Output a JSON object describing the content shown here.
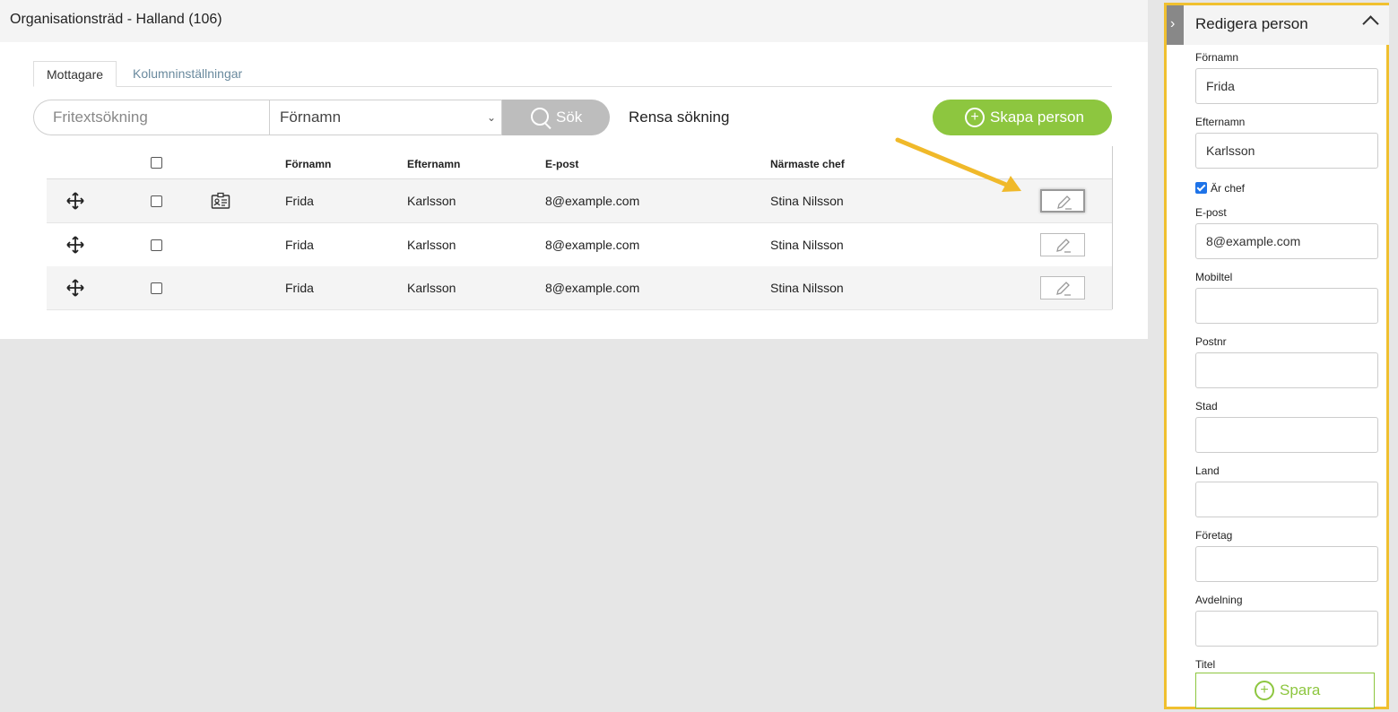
{
  "header": {
    "title": "Organisationsträd - Halland (106)"
  },
  "tabs": [
    {
      "label": "Mottagare",
      "active": true
    },
    {
      "label": "Kolumninställningar",
      "active": false
    }
  ],
  "search": {
    "placeholder": "Fritextsökning",
    "field_select": "Förnamn",
    "search_button": "Sök",
    "clear_button": "Rensa sökning",
    "create_button": "Skapa person"
  },
  "table": {
    "columns": [
      "Förnamn",
      "Efternamn",
      "E-post",
      "Närmaste chef"
    ],
    "rows": [
      {
        "first": "Frida",
        "last": "Karlsson",
        "email": "8@example.com",
        "manager": "Stina Nilsson"
      },
      {
        "first": "Frida",
        "last": "Karlsson",
        "email": "8@example.com",
        "manager": "Stina Nilsson"
      },
      {
        "first": "Frida",
        "last": "Karlsson",
        "email": "8@example.com",
        "manager": "Stina Nilsson"
      }
    ]
  },
  "panel": {
    "title": "Redigera person",
    "fields": {
      "fornamn": {
        "label": "Förnamn",
        "value": "Frida"
      },
      "efternamn": {
        "label": "Efternamn",
        "value": "Karlsson"
      },
      "epost": {
        "label": "E-post",
        "value": "8@example.com"
      },
      "mobiltel": {
        "label": "Mobiltel",
        "value": ""
      },
      "postnr": {
        "label": "Postnr",
        "value": ""
      },
      "stad": {
        "label": "Stad",
        "value": ""
      },
      "land": {
        "label": "Land",
        "value": ""
      },
      "foretag": {
        "label": "Företag",
        "value": ""
      },
      "avdelning": {
        "label": "Avdelning",
        "value": ""
      },
      "titel": {
        "label": "Titel"
      }
    },
    "ar_chef": {
      "label": "Är chef",
      "checked": true
    },
    "save_button": "Spara"
  },
  "colors": {
    "accent_green": "#8dc63f",
    "highlight_yellow": "#f0c02f",
    "checkbox_blue": "#1e73e8"
  }
}
